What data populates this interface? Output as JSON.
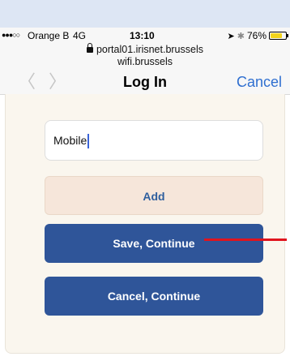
{
  "status_bar": {
    "signal": "●●●○○",
    "carrier": "Orange B",
    "network": "4G",
    "time": "13:10",
    "location_icon": "location-arrow-icon",
    "bluetooth_icon": "bluetooth-icon",
    "battery_percent": "76%",
    "battery_level": 0.76,
    "battery_color": "#f2d31b"
  },
  "address_bar": {
    "host": "portal01.irisnet.brussels",
    "subtitle": "wifi.brussels"
  },
  "nav": {
    "back_glyph": "〈",
    "forward_glyph": "〉",
    "title": "Log In",
    "cancel_label": "Cancel"
  },
  "form": {
    "device_name_value": "Mobile",
    "add_label": "Add",
    "save_label": "Save, Continue",
    "cancel_continue_label": "Cancel, Continue"
  },
  "colors": {
    "accent_blue": "#2f5599",
    "link_blue": "#2f6fd0",
    "annotation_red": "#e0141e"
  }
}
